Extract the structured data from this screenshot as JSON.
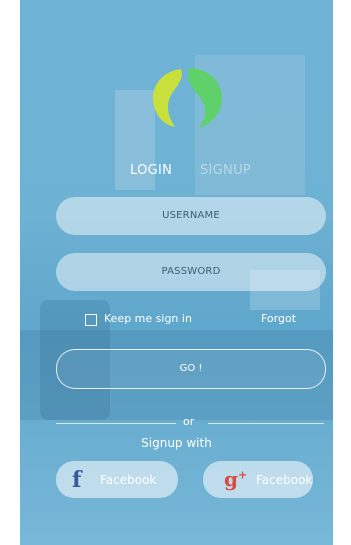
{
  "brand": {
    "logo_colors": [
      "#c8e03c",
      "#5fd06a"
    ]
  },
  "tabs": {
    "login": "LOGIN",
    "signup": "SIGNUP",
    "active": "login"
  },
  "form": {
    "username_placeholder": "USERNAME",
    "password_placeholder": "PASSWORD",
    "keep_signed_in_label": "Keep me sign in",
    "keep_signed_in_checked": false,
    "forgot_label": "Forgot",
    "submit_label": "GO !"
  },
  "social": {
    "or_label": "or",
    "signup_with_label": "Signup with",
    "facebook_icon": "facebook-icon",
    "facebook_label": "Facebook",
    "google_icon": "google-plus-icon",
    "google_label": "Facebook"
  },
  "colors": {
    "panel_bg": "#6db1d3",
    "text": "#ffffff",
    "field_text": "#3f5f75",
    "facebook": "#3b5a99",
    "google": "#dc4a3d"
  }
}
